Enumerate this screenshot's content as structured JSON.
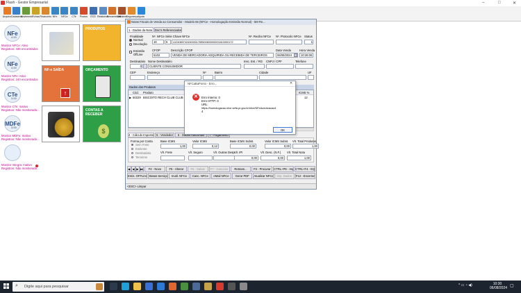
{
  "app": {
    "title": "Flash - Gestor Empresarial",
    "window_controls": [
      "–",
      "□",
      "✕"
    ]
  },
  "toolbar": [
    {
      "label": "Arquivo",
      "color": "#e87b1f"
    },
    {
      "label": "Cadastros",
      "color": "#3a7fc9"
    },
    {
      "label": "Movimento",
      "color": "#6b9a3a"
    },
    {
      "label": "Fichas",
      "color": "#c9a227"
    },
    {
      "label": "Financeiro",
      "color": "#d9872c"
    },
    {
      "label": "NFe",
      "color": "#3b85c4"
    },
    {
      "label": "NFCe",
      "color": "#3b85c4"
    },
    {
      "label": "CTe",
      "color": "#3b85c4"
    },
    {
      "label": "Postos",
      "color": "#d54a2a"
    },
    {
      "label": "ECD",
      "color": "#3f6fb0"
    },
    {
      "label": "Relatórios",
      "color": "#5d8bc4"
    },
    {
      "label": "Ferramentas",
      "color": "#d0702b"
    },
    {
      "label": "Utilitários",
      "color": "#a24f2d"
    },
    {
      "label": "Segurança",
      "color": "#e28a2b"
    },
    {
      "label": "Ajuda",
      "color": "#2d87d8"
    }
  ],
  "sidebar": [
    {
      "logo": "NFe",
      "sub": "4.00",
      "line1": "Monitor NFCe: Ativo",
      "line2": "Registros: 436 encontrados"
    },
    {
      "logo": "NFe",
      "sub": "4.00",
      "line1": "Monitor NFe: Ativo",
      "line2": "Registros: 240 encontrados"
    },
    {
      "logo": "CTe",
      "sub": "3.00",
      "line1": "Monitor CTe: Inativo",
      "line2": "Registros: Não monitorado..."
    },
    {
      "logo": "MDFe",
      "sub": "3.00",
      "line1": "Monitor MDFe: Inativo",
      "line2": "Registros: Não monitorado..."
    },
    {
      "logo": "",
      "sub": "",
      "line1": "Monitor Integra: Inativo",
      "line2": "Registros: Não monitorado..."
    }
  ],
  "tiles": [
    {
      "label": "PRODUTOS",
      "color": "#f2b32d"
    },
    {
      "label": "NF-e SAÍDA",
      "color": "#e4723b"
    },
    {
      "label": "ORÇAMENTO",
      "color": "#2f9f47"
    },
    {
      "label": "CONTAS A RECEBER",
      "color": "#2f9f47"
    }
  ],
  "nfce_window": {
    "title": "Notas Fiscais de Venda ao Consumidor - Modelo 65 (NFCe - Homologação Emissão Normal) - 5M Re...",
    "tabs": [
      "1 - Dados da Nota",
      "Doc's Referenciados"
    ],
    "finalidade": {
      "label": "Finalidade",
      "options": [
        "Normal",
        "Devolução"
      ],
      "selected": "Normal"
    },
    "series_label": "Nº. NFCe Série Chave NFCe",
    "numero": "16",
    "serie": "6",
    "chave": "41240897424300001765500600000001610000172",
    "nr_recibo_label": "Nº. Recibo NFCe",
    "protocolo_label": "Nº. Protocolo NFCe",
    "status_label": "Status",
    "status_value": "1",
    "emissao_label": "Emissão OffLine",
    "cfop_label": "CFOP",
    "cfop_value": "5102",
    "descricao_cfop_label": "Descrição CFOP",
    "descricao_cfop_value": "VENDA DE MERCADORIA ADQUIRIDA OU RECEBIDA DE TERCEIROS",
    "data_venda_label": "Data Venda",
    "data_venda_value": "06/08/2024",
    "hora_venda_label": "Hora Venda",
    "hora_venda_value": "10:28:06",
    "destinatario_label": "Destinatário",
    "destinatario_code": "0",
    "nome_dest_label": "Nome Destinatário",
    "nome_dest_value": "CLIENTE CONSUMIDOR",
    "insc_label": "Insc. Est. / RG",
    "cnpj_label": "CNPJ / CPF",
    "telefone_label": "Telefone",
    "cep_label": "CEP",
    "endereco_label": "Endereço",
    "numero_label": "Nº",
    "bairro_label": "Bairro",
    "cidade_label": "Cidade",
    "uf_label": "UF",
    "produtos_header": "Dados dos Produtos",
    "produtos_cols": [
      "Cód.",
      "Produto",
      "ICMS %"
    ],
    "produto_row": {
      "cod": "50229",
      "produto": "BISCOITO RECH CLUB CLUB",
      "icms": "12"
    },
    "bottom_tabs": [
      "4 - Cálculo Imposto",
      "5 - Vendedor",
      "6 - Dados Adicionais",
      "7 - Pagamento"
    ],
    "forma_label": "Forma por Conta",
    "forma_opts": [
      "Sem Frete",
      "Emitente",
      "Destinatário",
      "Terceiros"
    ],
    "totais": [
      {
        "label": "Base ICMS",
        "value": "1,00"
      },
      {
        "label": "Valor ICMS",
        "value": "0,12"
      },
      {
        "label": "Base ICMS Subst.",
        "value": "0,00"
      },
      {
        "label": "Valor ICMS Subst.",
        "value": "0,00"
      },
      {
        "label": "Vlr. Total Produtos",
        "value": "1,00"
      }
    ],
    "totais2": [
      {
        "label": "Vlr. Frete",
        "value": ""
      },
      {
        "label": "Vlr. Seguro",
        "value": ""
      },
      {
        "label": "Vlr. Outras Desp.",
        "value": ""
      },
      {
        "label": "Vlr. IPI",
        "value": "0,00"
      },
      {
        "label": "Vlr. Desc. (N.F.)",
        "value": "0,00"
      },
      {
        "label": "Vlr. Total Nota",
        "value": "1,00"
      }
    ],
    "buttons_row1": [
      {
        "label": "F4 - Novo",
        "enabled": true
      },
      {
        "label": "F5 - Alterar",
        "enabled": true
      },
      {
        "label": "F6 - Salvar",
        "enabled": false
      },
      {
        "label": "F7 - Cancelar",
        "enabled": false
      },
      {
        "label": "Retrans...",
        "enabled": true
      },
      {
        "label": "F3 - Procurar",
        "enabled": true
      },
      {
        "label": "CTRL+P6 - Imprimir",
        "enabled": true
      },
      {
        "label": "CTRL+F4 - EQP",
        "enabled": true
      }
    ],
    "buttons_row2": [
      {
        "label": "Emis. OFFLine",
        "enabled": true
      },
      {
        "label": "Status Serviço",
        "enabled": true
      },
      {
        "label": "Inutil. NFCe",
        "enabled": true
      },
      {
        "label": "Canc. NFCe",
        "enabled": true
      },
      {
        "label": "eMail NFCe",
        "enabled": true
      },
      {
        "label": "Gerar PDF",
        "enabled": true
      },
      {
        "label": "Atualizar NFCe",
        "enabled": true
      },
      {
        "label": "Imp. Dados",
        "enabled": false
      },
      {
        "label": "F12 - Encerrar",
        "enabled": true
      }
    ],
    "status_bar": "<ESC> Limpar"
  },
  "dialog": {
    "title": "NFCaBaPonto - Erro...",
    "lines": [
      "Erro Interno: 0",
      "Erro HTTP: 0",
      "URL:",
      "https://homologacao.nfce.sefa.pr.gov.br/nfce/NFeAutorizacao4",
      "4"
    ],
    "ok_label": "OK"
  },
  "taskbar": {
    "search_placeholder": "Digite aqui para pesquisar",
    "time": "10:30",
    "date": "06/08/2024",
    "apps": [
      {
        "name": "task-view",
        "color": "#2b3a4c"
      },
      {
        "name": "edge",
        "color": "#1fa0d8"
      },
      {
        "name": "explorer",
        "color": "#f0c24a"
      },
      {
        "name": "store",
        "color": "#3a6fd6"
      },
      {
        "name": "mail",
        "color": "#2e78d6"
      },
      {
        "name": "firefox",
        "color": "#e3652f"
      },
      {
        "name": "chrome",
        "color": "#4a8f3f"
      },
      {
        "name": "app1",
        "color": "#4a6a9a"
      },
      {
        "name": "flash",
        "color": "#c8a24a"
      },
      {
        "name": "anydesk",
        "color": "#d83a2e"
      },
      {
        "name": "app2",
        "color": "#555"
      },
      {
        "name": "app3",
        "color": "#8a8a8a"
      }
    ]
  }
}
